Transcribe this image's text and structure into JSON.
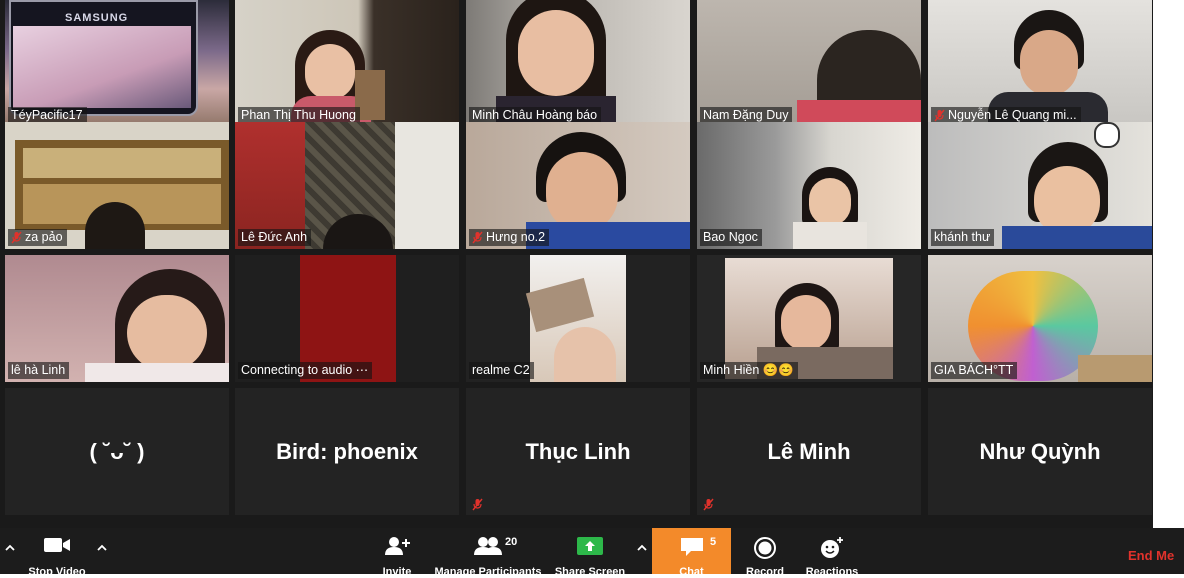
{
  "participants": [
    {
      "name": "TéyPacific17",
      "muted": false
    },
    {
      "name": "Phan Thị Thu Huong",
      "muted": false
    },
    {
      "name": "Minh Châu Hoàng báo",
      "muted": false
    },
    {
      "name": "Nam Đặng Duy",
      "muted": false
    },
    {
      "name": "Nguyễn Lê Quang mi...",
      "muted": true
    },
    {
      "name": "za pảo",
      "muted": true
    },
    {
      "name": "Lê Đức Anh",
      "muted": false
    },
    {
      "name": "Hưng no.2",
      "muted": true
    },
    {
      "name": "Bao Ngoc",
      "muted": false
    },
    {
      "name": "khánh thư",
      "muted": false
    },
    {
      "name": "lê hà Linh",
      "muted": false
    },
    {
      "name": "Connecting to audio ⋯",
      "muted": false
    },
    {
      "name": "realme C2",
      "muted": false
    },
    {
      "name": "Minh Hiền 😊😊",
      "muted": false
    },
    {
      "name": "GIA BÁCH°TT",
      "muted": false
    },
    {
      "name": "( ˘ᴗ˘ )",
      "muted": false
    },
    {
      "name": "Bird: phoenix",
      "muted": false
    },
    {
      "name": "Thục Linh",
      "muted": true
    },
    {
      "name": "Lê Minh",
      "muted": true
    },
    {
      "name": "Như Quỳnh",
      "muted": false
    }
  ],
  "toolbar": {
    "stop_video": "Stop Video",
    "invite": "Invite",
    "manage_participants": "Manage Participants",
    "participants_count": "20",
    "share_screen": "Share Screen",
    "chat": "Chat",
    "chat_count": "5",
    "record": "Record",
    "reactions": "Reactions",
    "end_meeting": "End Me"
  },
  "colors": {
    "chat_highlight": "#f38a2a",
    "share_green": "#2db84a",
    "end_red": "#e0322c",
    "active_speaker_border": "#e4e07a"
  }
}
